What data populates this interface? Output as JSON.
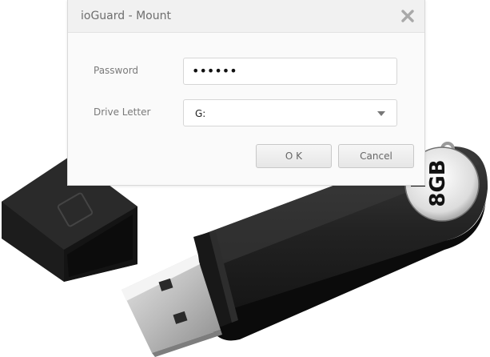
{
  "window": {
    "title": "ioGuard - Mount"
  },
  "form": {
    "password_label": "Password",
    "password_value": "••••••",
    "drive_letter_label": "Drive Letter",
    "drive_letter_value": "G:"
  },
  "buttons": {
    "ok_label": "O K",
    "cancel_label": "Cancel"
  },
  "device": {
    "capacity_label": "8GB"
  },
  "icons": {
    "close": "close-icon",
    "dropdown": "chevron-down-icon"
  },
  "colors": {
    "dialog_bg": "#fafafa",
    "titlebar_bg": "#f1f1f1",
    "drive_body": "#1f1f1f"
  }
}
